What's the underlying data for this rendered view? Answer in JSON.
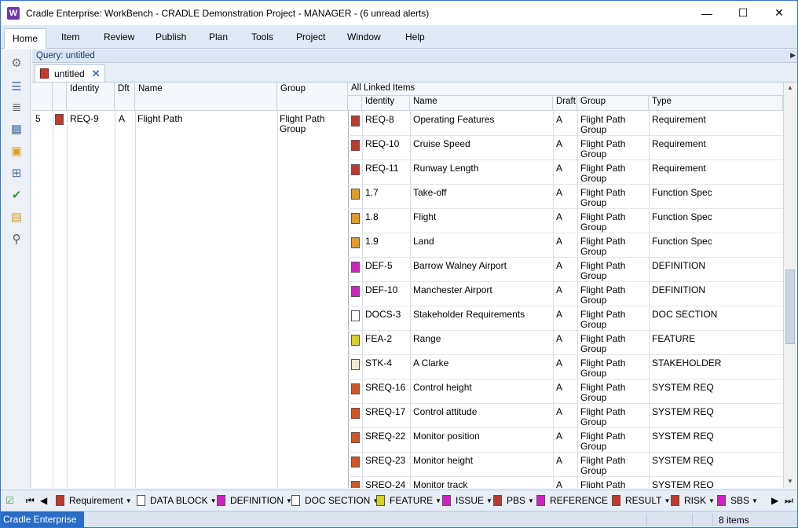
{
  "window": {
    "app_icon": "W",
    "title": "Cradle Enterprise: WorkBench - CRADLE Demonstration Project - MANAGER - (6 unread alerts)",
    "minimize": "—",
    "maximize": "☐",
    "close": "✕"
  },
  "menu": [
    "Home",
    "Item",
    "Review",
    "Publish",
    "Plan",
    "Tools",
    "Project",
    "Window",
    "Help"
  ],
  "query": {
    "label": "Query: untitled"
  },
  "tab": {
    "label": "untitled",
    "close": "✕"
  },
  "columns": {
    "identity": "Identity",
    "dft": "Dft",
    "name": "Name",
    "group": "Group",
    "linked": "All Linked Items",
    "l_identity": "Identity",
    "l_name": "Name",
    "l_draft": "Draft",
    "l_group": "Group",
    "l_type": "Type"
  },
  "main_row": {
    "num": "5",
    "identity": "REQ-9",
    "dft": "A",
    "name": "Flight Path",
    "group": "Flight Path Group",
    "icon_color": "#c0392b"
  },
  "linked_items": [
    {
      "identity": "REQ-8",
      "name": "Operating Features",
      "draft": "A",
      "group": "Flight Path Group",
      "type": "Requirement",
      "color": "#c0392b"
    },
    {
      "identity": "REQ-10",
      "name": "Cruise Speed",
      "draft": "A",
      "group": "Flight Path Group",
      "type": "Requirement",
      "color": "#c0392b"
    },
    {
      "identity": "REQ-11",
      "name": "Runway Length",
      "draft": "A",
      "group": "Flight Path Group",
      "type": "Requirement",
      "color": "#c0392b"
    },
    {
      "identity": "1.7",
      "name": "Take-off",
      "draft": "A",
      "group": "Flight Path Group",
      "type": "Function Spec",
      "color": "#e89a1c"
    },
    {
      "identity": "1.8",
      "name": "Flight",
      "draft": "A",
      "group": "Flight Path Group",
      "type": "Function Spec",
      "color": "#e89a1c"
    },
    {
      "identity": "1.9",
      "name": "Land",
      "draft": "A",
      "group": "Flight Path Group",
      "type": "Function Spec",
      "color": "#e89a1c"
    },
    {
      "identity": "DEF-5",
      "name": "Barrow Walney Airport",
      "draft": "A",
      "group": "Flight Path Group",
      "type": "DEFINITION",
      "color": "#d21fc8"
    },
    {
      "identity": "DEF-10",
      "name": "Manchester Airport",
      "draft": "A",
      "group": "Flight Path Group",
      "type": "DEFINITION",
      "color": "#d21fc8"
    },
    {
      "identity": "DOCS-3",
      "name": "Stakeholder Requirements",
      "draft": "A",
      "group": "Flight Path Group",
      "type": "DOC SECTION",
      "color": "#ffffff"
    },
    {
      "identity": "FEA-2",
      "name": "Range",
      "draft": "A",
      "group": "Flight Path Group",
      "type": "FEATURE",
      "color": "#d8d21c"
    },
    {
      "identity": "STK-4",
      "name": "A Clarke",
      "draft": "A",
      "group": "Flight Path Group",
      "type": "STAKEHOLDER",
      "color": "#f2ead0"
    },
    {
      "identity": "SREQ-16",
      "name": "Control height",
      "draft": "A",
      "group": "Flight Path Group",
      "type": "SYSTEM REQ",
      "color": "#d9531e"
    },
    {
      "identity": "SREQ-17",
      "name": "Control attitude",
      "draft": "A",
      "group": "Flight Path Group",
      "type": "SYSTEM REQ",
      "color": "#d9531e"
    },
    {
      "identity": "SREQ-22",
      "name": "Monitor position",
      "draft": "A",
      "group": "Flight Path Group",
      "type": "SYSTEM REQ",
      "color": "#d9531e"
    },
    {
      "identity": "SREQ-23",
      "name": "Monitor height",
      "draft": "A",
      "group": "Flight Path Group",
      "type": "SYSTEM REQ",
      "color": "#d9531e"
    },
    {
      "identity": "SREQ-24",
      "name": "Monitor track",
      "draft": "A",
      "group": "Flight Path Group",
      "type": "SYSTEM REQ",
      "color": "#d9531e"
    }
  ],
  "bottom_bar": [
    {
      "label": "Requirement",
      "color": "#c0392b"
    },
    {
      "label": "DATA BLOCK",
      "color": "#ffffff"
    },
    {
      "label": "DEFINITION",
      "color": "#d21fc8"
    },
    {
      "label": "DOC SECTION",
      "color": "#ffffff"
    },
    {
      "label": "FEATURE",
      "color": "#d8d21c"
    },
    {
      "label": "ISSUE",
      "color": "#d21fc8"
    },
    {
      "label": "PBS",
      "color": "#c0392b"
    },
    {
      "label": "REFERENCE",
      "color": "#d21fc8"
    },
    {
      "label": "RESULT",
      "color": "#c0392b"
    },
    {
      "label": "RISK",
      "color": "#c0392b"
    },
    {
      "label": "SBS",
      "color": "#d21fc8"
    }
  ],
  "status": {
    "left": "Cradle Enterprise",
    "right": "8 items"
  }
}
